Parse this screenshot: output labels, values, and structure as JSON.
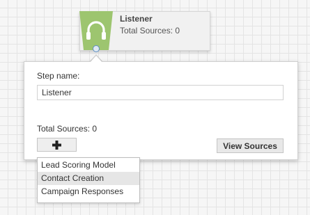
{
  "node": {
    "title": "Listener",
    "subtitle": "Total Sources: 0",
    "icon": "headphones-icon",
    "icon_color": "#9dc56f"
  },
  "panel": {
    "step_name_label": "Step name:",
    "step_name_value": "Listener",
    "total_sources": "Total Sources: 0",
    "add_icon": "plus-icon",
    "view_sources_label": "View Sources"
  },
  "dropdown": {
    "items": [
      {
        "label": "Lead Scoring Model"
      },
      {
        "label": "Contact Creation",
        "hovered": true
      },
      {
        "label": "Campaign Responses"
      }
    ]
  },
  "colors": {
    "accent_green": "#9dc56f",
    "connector_blue": "#5e8fc2"
  }
}
